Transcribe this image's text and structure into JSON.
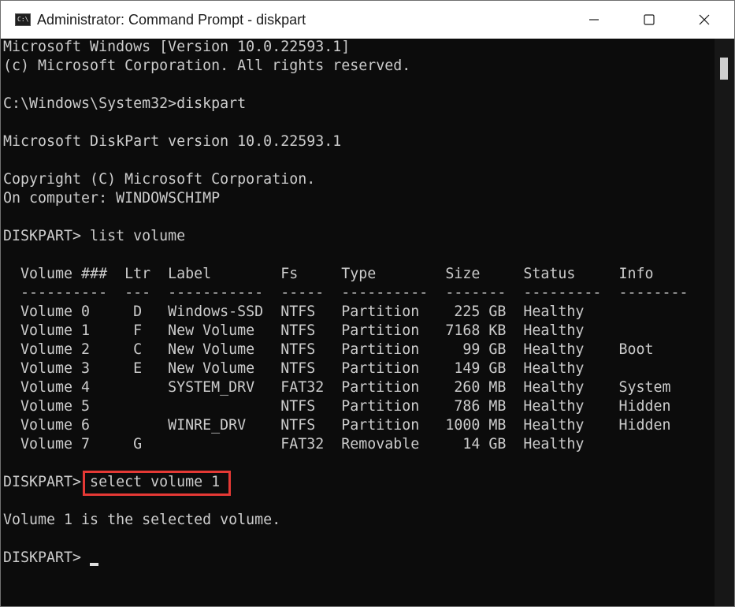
{
  "window": {
    "title": "Administrator: Command Prompt - diskpart",
    "icon": "cmd-app-icon",
    "icon_glyph": "C:\\"
  },
  "controls": {
    "minimize": "minimize-icon",
    "maximize": "maximize-icon",
    "close": "close-icon"
  },
  "console": {
    "lines": [
      "Microsoft Windows [Version 10.0.22593.1]",
      "(c) Microsoft Corporation. All rights reserved.",
      "",
      "C:\\Windows\\System32>diskpart",
      "",
      "Microsoft DiskPart version 10.0.22593.1",
      "",
      "Copyright (C) Microsoft Corporation.",
      "On computer: WINDOWSCHIMP",
      "",
      "DISKPART> list volume",
      "",
      "  Volume ###  Ltr  Label        Fs     Type        Size     Status     Info",
      "  ----------  ---  -----------  -----  ----------  -------  ---------  --------",
      "  Volume 0     D   Windows-SSD  NTFS   Partition    225 GB  Healthy",
      "  Volume 1     F   New Volume   NTFS   Partition   7168 KB  Healthy",
      "  Volume 2     C   New Volume   NTFS   Partition     99 GB  Healthy    Boot",
      "  Volume 3     E   New Volume   NTFS   Partition    149 GB  Healthy",
      "  Volume 4         SYSTEM_DRV   FAT32  Partition    260 MB  Healthy    System",
      "  Volume 5                      NTFS   Partition    786 MB  Healthy    Hidden",
      "  Volume 6         WINRE_DRV    NTFS   Partition   1000 MB  Healthy    Hidden",
      "  Volume 7     G                FAT32  Removable     14 GB  Healthy",
      "",
      "DISKPART> select volume 1",
      "",
      "Volume 1 is the selected volume.",
      "",
      "DISKPART> "
    ]
  },
  "colors": {
    "console_bg": "#0c0c0c",
    "console_text": "#cccccc",
    "highlight": "#e53935"
  }
}
